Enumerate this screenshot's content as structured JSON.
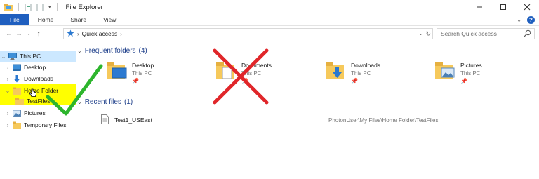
{
  "window": {
    "title": "File Explorer"
  },
  "ribbon": {
    "tabs": [
      "File",
      "Home",
      "Share",
      "View"
    ]
  },
  "address": {
    "crumb": "Quick access"
  },
  "search": {
    "placeholder": "Search Quick access"
  },
  "nav": {
    "items": [
      {
        "label": "This PC",
        "icon": "pc-icon",
        "selected": true,
        "expanded": true
      },
      {
        "label": "Desktop",
        "icon": "desktop-icon"
      },
      {
        "label": "Downloads",
        "icon": "download-arrow-icon"
      },
      {
        "label": "Home Folder",
        "icon": "folder-icon",
        "expanded": true
      },
      {
        "label": "TestFiles",
        "icon": "folder-icon"
      },
      {
        "label": "Pictures",
        "icon": "pictures-icon"
      },
      {
        "label": "Temporary Files",
        "icon": "folder-icon"
      }
    ]
  },
  "frequent": {
    "title": "Frequent folders",
    "count": "(4)",
    "items": [
      {
        "name": "Desktop",
        "location": "This PC"
      },
      {
        "name": "Documents",
        "location": "This PC"
      },
      {
        "name": "Downloads",
        "location": "This PC"
      },
      {
        "name": "Pictures",
        "location": "This PC"
      }
    ]
  },
  "recent": {
    "title": "Recent files",
    "count": "(1)",
    "items": [
      {
        "name": "Test1_USEast",
        "path": "PhotonUser\\My Files\\Home Folder\\TestFiles"
      }
    ]
  },
  "annotations": {
    "red_x": "over Documents folder",
    "green_check": "next to Home Folder"
  },
  "colors": {
    "file_tab": "#1f5fbf",
    "selected": "#cce8ff",
    "highlight": "#ffff00",
    "folder": "#f6c95b",
    "red_x": "#e0262a",
    "green_check": "#2db52d",
    "section_title": "#1e3f8a"
  }
}
